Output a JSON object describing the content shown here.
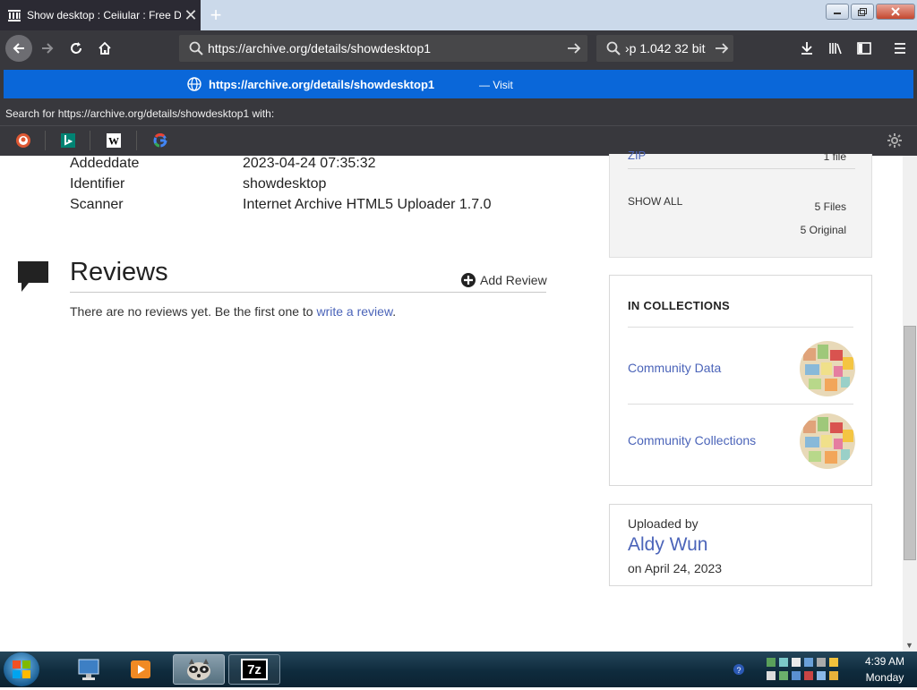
{
  "browser": {
    "tab": {
      "title": "Show desktop : Ceiiular : Free D",
      "close_glyph": "✕"
    },
    "new_tab_glyph": "+",
    "url_value": "https://archive.org/details/showdesktop1",
    "search_value": "›p 1.042 32 bit"
  },
  "dropdown": {
    "highlight_url": "https://archive.org/details/showdesktop1",
    "visit_label": "— Visit",
    "search_with_label": "Search for https://archive.org/details/showdesktop1 with:",
    "engines": [
      "duckduckgo",
      "bing",
      "wikipedia",
      "google"
    ]
  },
  "metadata": [
    {
      "key": "Addeddate",
      "value": "2023-04-24 07:35:32"
    },
    {
      "key": "Identifier",
      "value": "showdesktop"
    },
    {
      "key": "Scanner",
      "value": "Internet Archive HTML5 Uploader 1.7.0"
    }
  ],
  "reviews": {
    "title": "Reviews",
    "add_label": "Add Review",
    "empty_text": "There are no reviews yet. Be the first one to ",
    "write_link": "write a review",
    "period": "."
  },
  "files": {
    "zip_label": "ZIP",
    "zip_count": "1 file",
    "show_all": "SHOW ALL",
    "files_count": "5 Files",
    "original_count": "5 Original"
  },
  "collections": {
    "heading": "IN COLLECTIONS",
    "items": [
      {
        "label": "Community Data"
      },
      {
        "label": "Community Collections"
      }
    ]
  },
  "uploader": {
    "label": "Uploaded by",
    "name": "Aldy Wun",
    "date": "on April 24, 2023"
  },
  "taskbar": {
    "time": "4:39 AM",
    "day": "Monday",
    "app_7z_label": "7z"
  },
  "colors": {
    "accent_blue": "#0a67d9",
    "link": "#4b64b9",
    "toolbar": "#38383d"
  }
}
